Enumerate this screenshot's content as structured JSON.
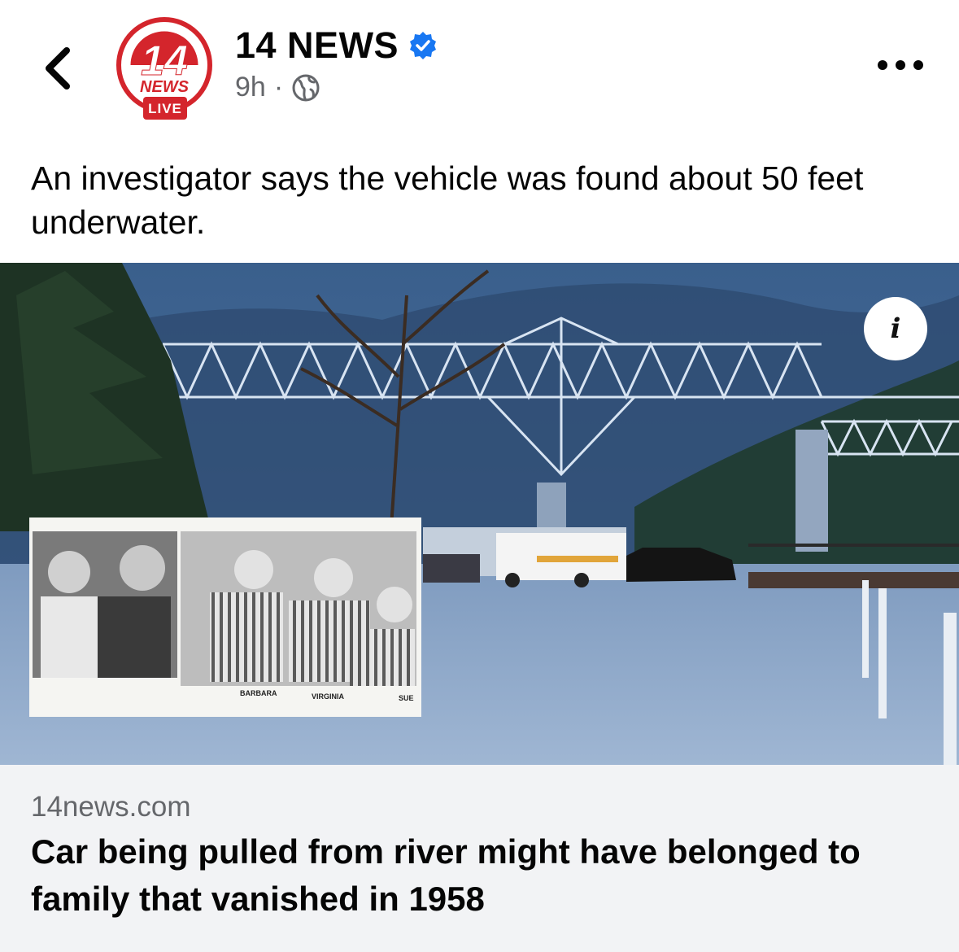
{
  "header": {
    "page_name": "14 NEWS",
    "time": "9h",
    "separator": "·",
    "audience_icon": "globe-icon",
    "back_icon": "chevron-left-icon",
    "more_icon": "more-horizontal-icon",
    "verified_icon": "verified-badge-icon"
  },
  "avatar": {
    "number": "14",
    "wordmark": "NEWS",
    "badge": "LIVE"
  },
  "post": {
    "text": "An investigator says the vehicle was found about 50 feet underwater."
  },
  "media": {
    "info_icon": "info-icon",
    "inset_captions": [
      "BARBARA",
      "VIRGINIA",
      "SUE"
    ]
  },
  "link": {
    "domain": "14news.com",
    "title": "Car being pulled from river might have belonged to family that vanished in 1958"
  },
  "colors": {
    "brand_red": "#d4252c",
    "verified_blue": "#1877f2",
    "secondary_text": "#65676b",
    "link_card_bg": "#f2f3f5"
  }
}
